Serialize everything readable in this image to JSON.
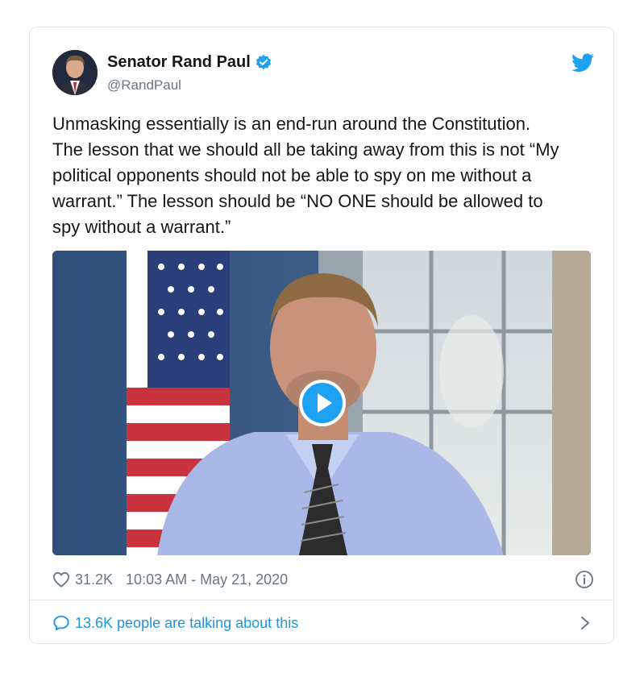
{
  "author": {
    "name": "Senator Rand Paul",
    "handle": "@RandPaul",
    "verified": true
  },
  "tweet": {
    "text": "Unmasking essentially is an end-run around the Constitution.\nThe lesson that we should all be taking away from this is not “My\npolitical opponents should not be able to spy on me without a\nwarrant.” The lesson should be “NO ONE should be allowed to\nspy without a warrant.”"
  },
  "media": {
    "type": "video",
    "play_icon": "play-icon"
  },
  "meta": {
    "likes": "31.2K",
    "timestamp": "10:03 AM - May 21, 2020"
  },
  "talking": {
    "label": "13.6K people are talking about this"
  },
  "colors": {
    "accent": "#1da1f2",
    "link": "#1b95e0",
    "muted": "#657786",
    "border": "#e1e8ed"
  },
  "icons": [
    "twitter-bird-icon",
    "verified-badge-icon",
    "heart-icon",
    "info-icon",
    "speech-bubble-icon",
    "chevron-right-icon",
    "play-icon"
  ]
}
